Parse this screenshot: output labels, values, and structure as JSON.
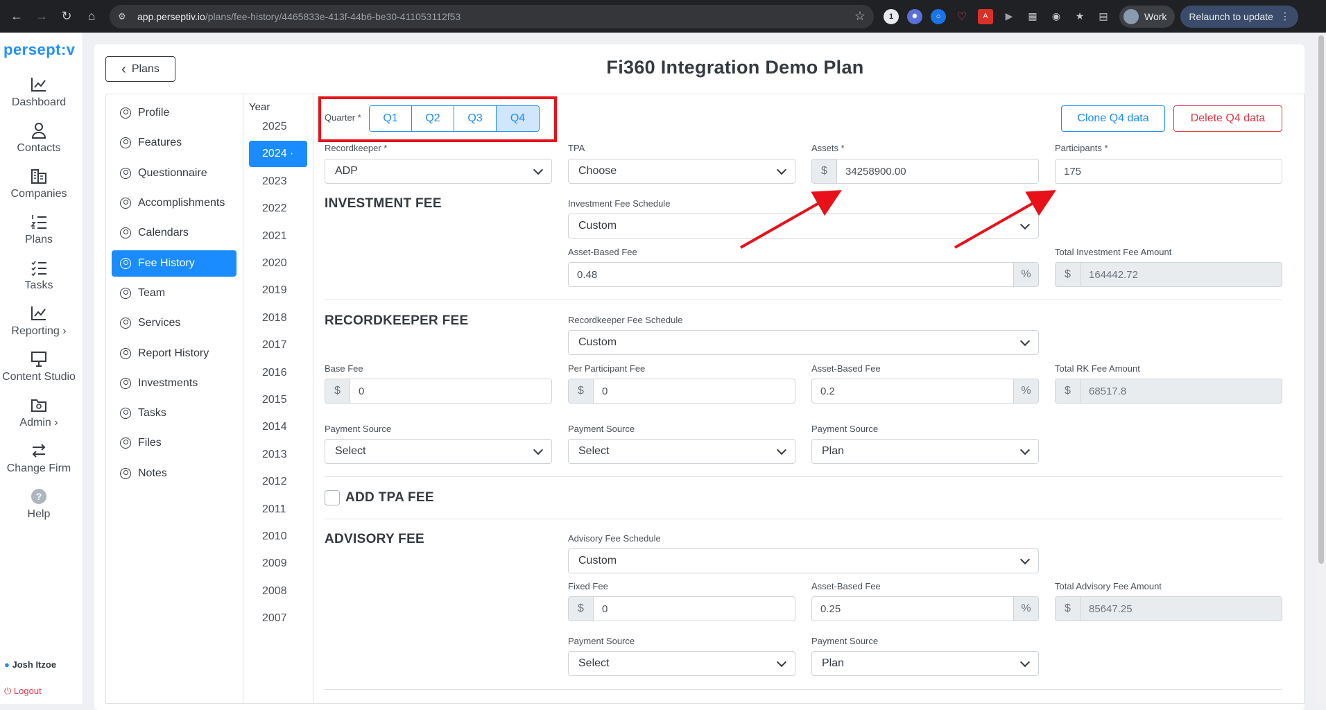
{
  "browser": {
    "url_host": "app.perseptiv.io",
    "url_path": "/plans/fee-history/4465833e-413f-44b6-be30-411053112f53",
    "profile": "Work",
    "relaunch": "Relaunch to update"
  },
  "nav": {
    "brand": "persept:v",
    "items": [
      "Dashboard",
      "Contacts",
      "Companies",
      "Plans",
      "Tasks",
      "Reporting",
      "Content Studio",
      "Admin",
      "Change Firm",
      "Help"
    ],
    "user": "Josh Itzoe",
    "logout": "Logout"
  },
  "page": {
    "back_label": "Plans",
    "title": "Fi360 Integration Demo Plan"
  },
  "side_menu": [
    "Profile",
    "Features",
    "Questionnaire",
    "Accomplishments",
    "Calendars",
    "Fee History",
    "Team",
    "Services",
    "Report History",
    "Investments",
    "Tasks",
    "Files",
    "Notes"
  ],
  "years": {
    "header": "Year",
    "list": [
      "2025",
      "2024 ·",
      "2023",
      "2022",
      "2021",
      "2020",
      "2019",
      "2018",
      "2017",
      "2016",
      "2015",
      "2014",
      "2013",
      "2012",
      "2011",
      "2010",
      "2009",
      "2008",
      "2007"
    ]
  },
  "quarter": {
    "label": "Quarter *",
    "options": [
      "Q1",
      "Q2",
      "Q3",
      "Q4"
    ],
    "selected": "Q4"
  },
  "actions": {
    "clone": "Clone Q4 data",
    "delete": "Delete Q4 data"
  },
  "top": {
    "recordkeeper_label": "Recordkeeper *",
    "recordkeeper_value": "ADP",
    "tpa_label": "TPA",
    "tpa_value": "Choose",
    "assets_label": "Assets *",
    "assets_value": "34258900.00",
    "participants_label": "Participants *",
    "participants_value": "175"
  },
  "investment_fee": {
    "heading": "INVESTMENT FEE",
    "schedule_label": "Investment Fee Schedule",
    "schedule_value": "Custom",
    "asset_fee_label": "Asset-Based Fee",
    "asset_fee_value": "0.48",
    "total_label": "Total Investment Fee Amount",
    "total_value": "164442.72"
  },
  "recordkeeper_fee": {
    "heading": "RECORDKEEPER FEE",
    "schedule_label": "Recordkeeper Fee Schedule",
    "schedule_value": "Custom",
    "base_label": "Base Fee",
    "base_value": "0",
    "per_part_label": "Per Participant Fee",
    "per_part_value": "0",
    "asset_fee_label": "Asset-Based Fee",
    "asset_fee_value": "0.2",
    "total_label": "Total RK Fee Amount",
    "total_value": "68517.8",
    "ps_label": "Payment Source",
    "ps1": "Select",
    "ps2": "Select",
    "ps3": "Plan"
  },
  "tpa_fee": {
    "heading": "ADD TPA FEE"
  },
  "advisory_fee": {
    "heading": "ADVISORY FEE",
    "schedule_label": "Advisory Fee Schedule",
    "schedule_value": "Custom",
    "fixed_label": "Fixed Fee",
    "fixed_value": "0",
    "asset_fee_label": "Asset-Based Fee",
    "asset_fee_value": "0.25",
    "total_label": "Total Advisory Fee Amount",
    "total_value": "85647.25",
    "ps_label": "Payment Source",
    "ps1": "Select",
    "ps2": "Plan"
  },
  "symbols": {
    "dollar": "$",
    "percent": "%"
  },
  "colors": {
    "accent": "#1a8cff",
    "highlight_box": "#e8111a",
    "danger": "#dc3545"
  }
}
